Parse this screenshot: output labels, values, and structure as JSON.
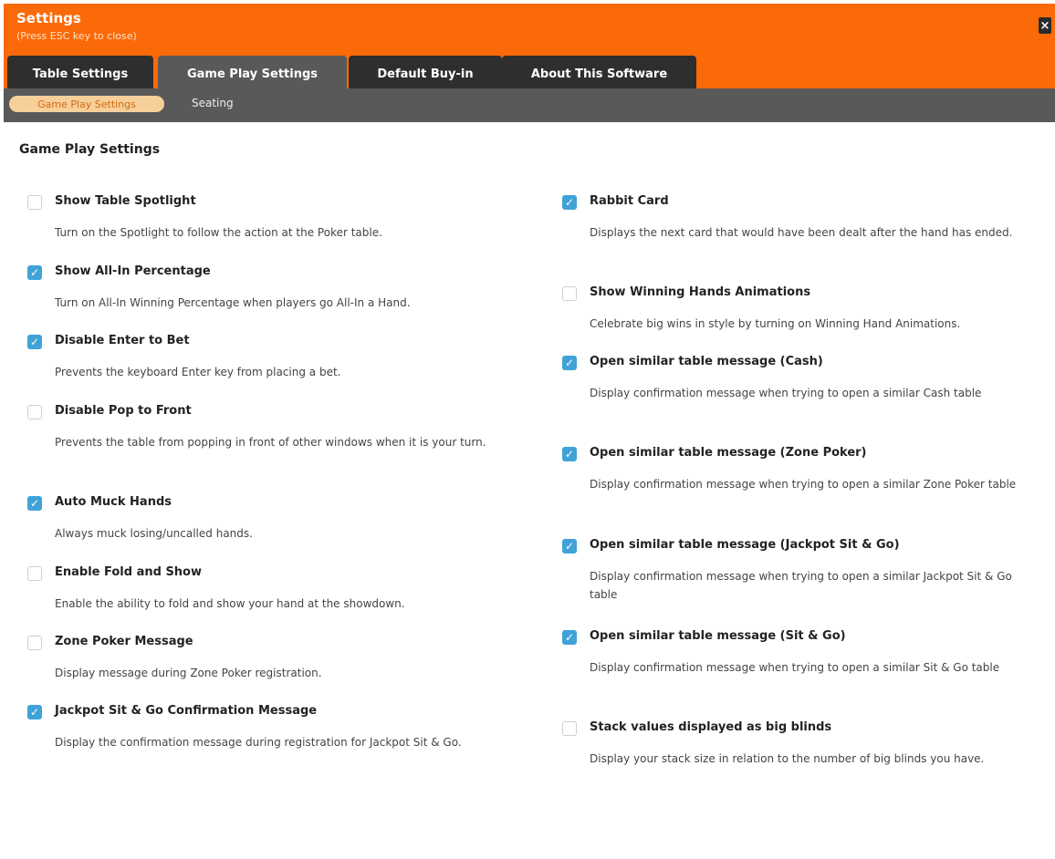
{
  "window": {
    "title": "Settings",
    "subtitle": "(Press ESC key to close)",
    "close_label": "×"
  },
  "tabs": [
    {
      "label": "Table Settings",
      "active": false
    },
    {
      "label": "Game Play Settings",
      "active": true
    },
    {
      "label": "Default Buy-in",
      "active": false
    },
    {
      "label": "About This Software",
      "active": false
    }
  ],
  "subtabs": [
    {
      "label": "Game Play Settings",
      "active": true
    },
    {
      "label": "Seating",
      "active": false
    }
  ],
  "section": {
    "title": "Game Play Settings"
  },
  "left": [
    {
      "label": "Show Table Spotlight",
      "checked": false,
      "desc": "Turn on the Spotlight to follow the action at the Poker table."
    },
    {
      "label": "Show All-In Percentage",
      "checked": true,
      "desc": "Turn on All-In Winning Percentage when players go All-In a Hand."
    },
    {
      "label": "Disable Enter to Bet",
      "checked": true,
      "desc": "Prevents the keyboard Enter key from placing a bet."
    },
    {
      "label": "Disable Pop to Front",
      "checked": false,
      "desc": "Prevents the table from popping in front of other windows when it is your turn."
    },
    {
      "label": "Auto Muck Hands",
      "checked": true,
      "desc": "Always muck losing/uncalled hands."
    },
    {
      "label": "Enable Fold and Show",
      "checked": false,
      "desc": "Enable the ability to fold and show your hand at the showdown."
    },
    {
      "label": "Zone Poker Message",
      "checked": false,
      "desc": "Display message during Zone Poker registration."
    },
    {
      "label": "Jackpot Sit & Go Confirmation Message",
      "checked": true,
      "desc": "Display the confirmation message during registration for Jackpot Sit & Go."
    }
  ],
  "right": [
    {
      "label": "Rabbit Card",
      "checked": true,
      "desc": "Displays the next card that would have been dealt after the hand has ended."
    },
    {
      "label": "Show Winning Hands Animations",
      "checked": false,
      "desc": "Celebrate big wins in style by turning on Winning Hand Animations."
    },
    {
      "label": "Open similar table message (Cash)",
      "checked": true,
      "desc": "Display confirmation message when trying to open a similar Cash table"
    },
    {
      "label": "Open similar table message (Zone Poker)",
      "checked": true,
      "desc": "Display confirmation message when trying to open a similar Zone Poker table"
    },
    {
      "label": "Open similar table message (Jackpot Sit & Go)",
      "checked": true,
      "desc": "Display confirmation message when trying to open a similar Jackpot Sit & Go table"
    },
    {
      "label": "Open similar table message (Sit & Go)",
      "checked": true,
      "desc": "Display confirmation message when trying to open a similar Sit & Go table"
    },
    {
      "label": "Stack values displayed as big blinds",
      "checked": false,
      "desc": "Display your stack size in relation to the number of big blinds you have."
    }
  ],
  "colors": {
    "header": "#fb6a08",
    "tab_bar": "#2e2e2e",
    "active_tab": "#595959",
    "checkbox_checked": "#3fa3d8",
    "pill": "#f7cf9a"
  },
  "icons": {
    "close": "close-icon",
    "check": "checkmark-icon"
  }
}
